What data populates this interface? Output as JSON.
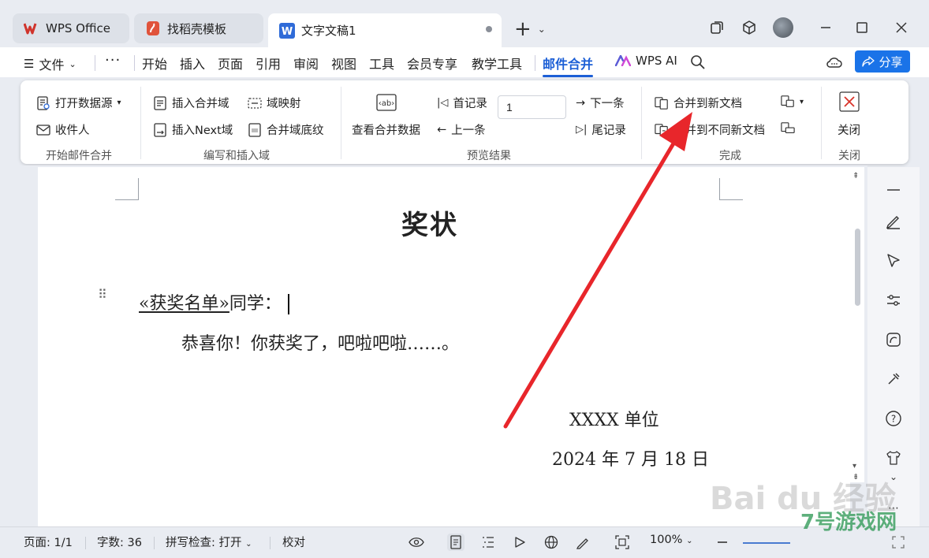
{
  "titlebar": {
    "tabs": [
      {
        "label": "WPS Office",
        "icon": "wps-logo-icon"
      },
      {
        "label": "找稻壳模板",
        "icon": "docer-icon"
      },
      {
        "label": "文字文稿1",
        "icon": "word-doc-icon"
      }
    ],
    "colors": {
      "wps_red": "#d0342c",
      "doc_blue": "#2f6bd8",
      "docer_red": "#e0533b"
    }
  },
  "menu": {
    "file": "文件",
    "items": [
      "开始",
      "插入",
      "页面",
      "引用",
      "审阅",
      "视图",
      "工具",
      "会员专享",
      "教学工具",
      "邮件合并"
    ],
    "active": "邮件合并",
    "wps_ai": "WPS AI",
    "share": "分享"
  },
  "ribbon": {
    "group_start": {
      "label": "开始邮件合并",
      "open_data_source": "打开数据源",
      "recipients": "收件人"
    },
    "group_write": {
      "label": "编写和插入域",
      "insert_merge_field": "插入合并域",
      "field_mapping": "域映射",
      "insert_next_field": "插入Next域",
      "merge_field_shading": "合并域底纹"
    },
    "group_preview": {
      "label": "预览结果",
      "view_merged_data": "查看合并数据",
      "first_record": "首记录",
      "prev_record": "上一条",
      "record_value": "1",
      "next_record": "下一条",
      "last_record": "尾记录"
    },
    "group_finish": {
      "label": "完成",
      "merge_new_doc": "合并到新文档",
      "merge_separate_docs": "合并到不同新文档"
    },
    "group_close": {
      "label": "关闭",
      "close": "关闭"
    }
  },
  "document": {
    "title": "奖状",
    "merge_field": "«获奖名单»",
    "salutation_suffix": "同学：",
    "body": "恭喜你！你获奖了，吧啦吧啦……。",
    "signature_org": "XXXX 单位",
    "signature_date": "2024 年 7 月 18 日"
  },
  "statusbar": {
    "page": "页面: 1/1",
    "word_count": "字数: 36",
    "spell_check": "拼写检查: 打开",
    "proofread": "校对",
    "zoom": "100%"
  },
  "watermark": {
    "baidu": "Bai du 经验",
    "site": "7号游戏网"
  },
  "annotation": {
    "arrow_color": "#e8262b"
  }
}
